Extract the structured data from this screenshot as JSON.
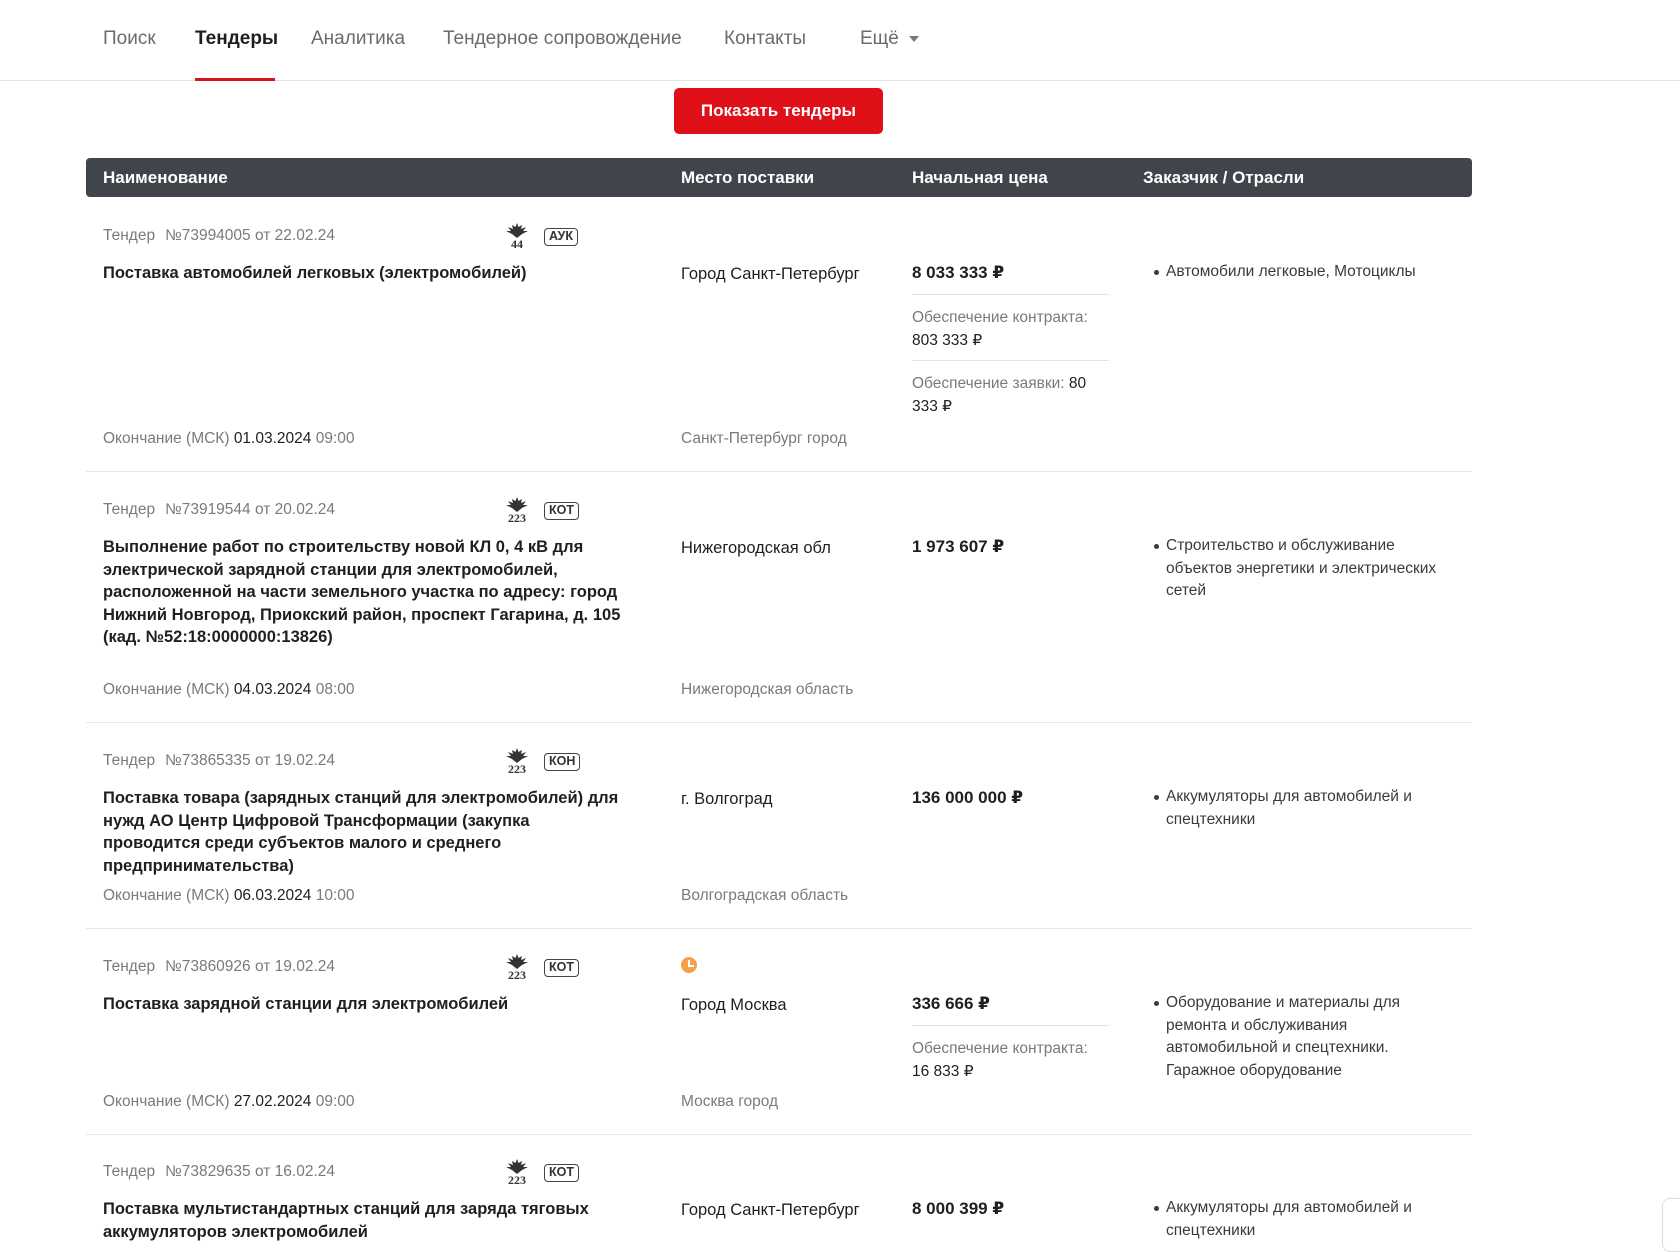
{
  "nav": {
    "items": [
      {
        "label": "Поиск"
      },
      {
        "label": "Тендеры"
      },
      {
        "label": "Аналитика"
      },
      {
        "label": "Тендерное сопровождение"
      },
      {
        "label": "Контакты"
      },
      {
        "label": "Ещё"
      }
    ]
  },
  "show_button": "Показать тендеры",
  "table": {
    "headers": [
      "Наименование",
      "Место поставки",
      "Начальная цена",
      "Заказчик / Отрасли"
    ]
  },
  "tenders": [
    {
      "kind": "Тендер",
      "number": "№73994005 от 22.02.24",
      "law": "44",
      "ptype": "АУК",
      "title": "Поставка автомобилей легковых (электромобилей)",
      "place": "Город Санкт-Петербург",
      "region": "Санкт-Петербург город",
      "deadline_label": "Окончание (МСК)",
      "deadline_date": "01.03.2024",
      "deadline_time": "09:00",
      "price": "8 033 333 ₽",
      "contract_label": "Обеспечение контракта:",
      "contract_value": "803 333 ₽",
      "bid_label": "Обеспечение заявки:",
      "bid_value": "80 333 ₽",
      "industry": "Автомобили легковые, Мотоциклы"
    },
    {
      "kind": "Тендер",
      "number": "№73919544 от 20.02.24",
      "law": "223",
      "ptype": "КОТ",
      "title": "Выполнение работ по строительству новой КЛ 0, 4 кВ для электрической зарядной станции для электромобилей, расположенной на части земельного участка по адресу: город Нижний Новгород, Приокский район, проспект Гагарина, д. 105 (кад. №52:18:0000000:13826)",
      "place": "Нижегородская обл",
      "region": "Нижегородская область",
      "deadline_label": "Окончание (МСК)",
      "deadline_date": "04.03.2024",
      "deadline_time": "08:00",
      "price": "1 973 607 ₽",
      "industry": "Строительство и обслуживание объектов энергетики и электрических сетей"
    },
    {
      "kind": "Тендер",
      "number": "№73865335 от 19.02.24",
      "law": "223",
      "ptype": "КОН",
      "title": "Поставка товара (зарядных станций для электромобилей) для нужд АО Центр Цифровой Трансформации (закупка проводится среди субъектов малого и среднего предпринимательства)",
      "place": "г. Волгоград",
      "region": "Волгоградская область",
      "deadline_label": "Окончание (МСК)",
      "deadline_date": "06.03.2024",
      "deadline_time": "10:00",
      "price": "136 000 000 ₽",
      "industry": "Аккумуляторы для автомобилей и спецтехники"
    },
    {
      "kind": "Тендер",
      "number": "№73860926 от 19.02.24",
      "law": "223",
      "ptype": "КОТ",
      "title": "Поставка зарядной станции для электромобилей",
      "place": "Город Москва",
      "region": "Москва город",
      "deadline_label": "Окончание (МСК)",
      "deadline_date": "27.02.2024",
      "deadline_time": "09:00",
      "price": "336 666 ₽",
      "contract_label": "Обеспечение контракта:",
      "contract_value": "16 833 ₽",
      "industry": "Оборудование и материалы для ремонта и обслуживания автомобильной и спецтехники. Гаражное оборудование"
    },
    {
      "kind": "Тендер",
      "number": "№73829635 от 16.02.24",
      "law": "223",
      "ptype": "КОТ",
      "title": "Поставка мультистандартных станций для заряда тяговых аккумуляторов электромобилей",
      "place": "Город Санкт-Петербург",
      "price": "8 000 399 ₽",
      "industry": "Аккумуляторы для автомобилей и спецтехники"
    }
  ]
}
